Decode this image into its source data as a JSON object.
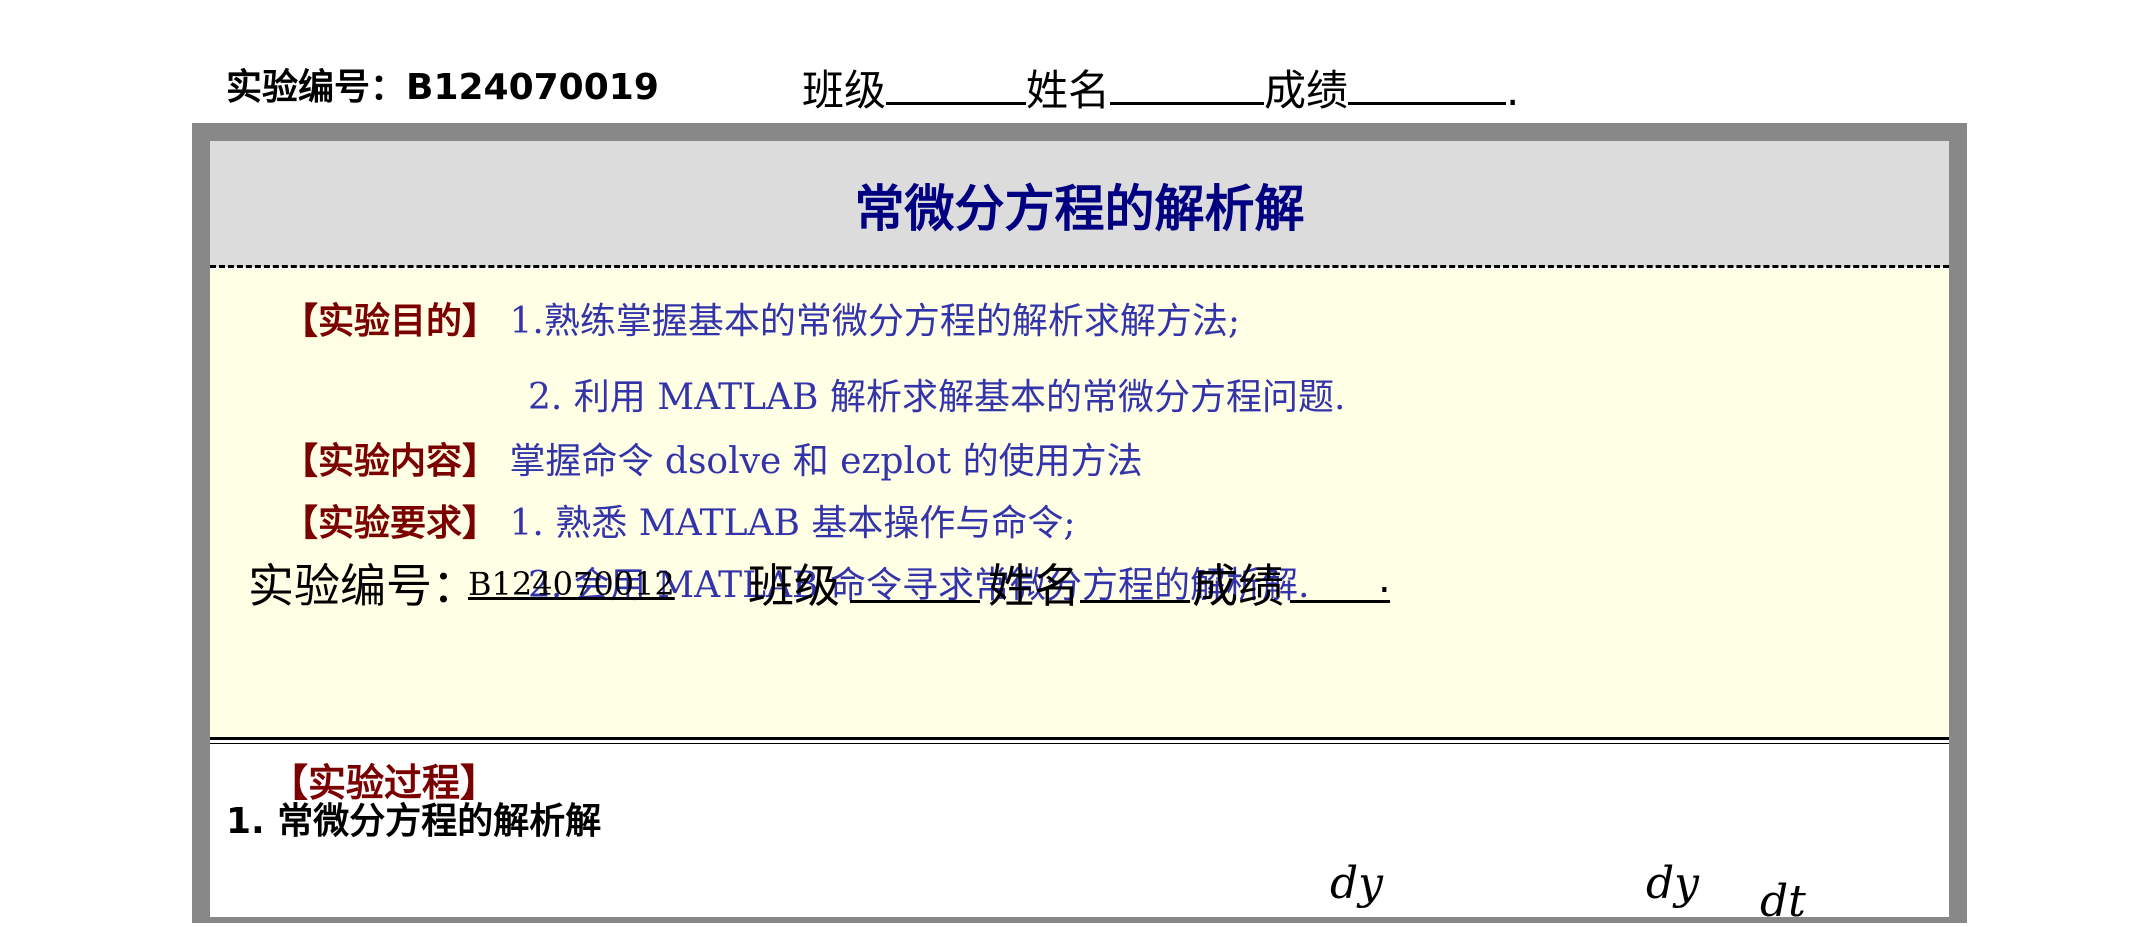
{
  "header": {
    "exp_label": "实验编号：B124070019",
    "class_label": "班级",
    "name_label": "姓名",
    "score_label": "成绩",
    "end_mark": "."
  },
  "title": "常微分方程的解析解",
  "objectives": {
    "purpose_tag": "【实验目的】",
    "purpose_1": "1.熟练掌握基本的常微分方程的解析求解方法;",
    "purpose_2": "2. 利用 MATLAB 解析求解基本的常微分方程问题.",
    "content_tag": "【实验内容】",
    "content": "掌握命令 dsolve 和 ezplot 的使用方法",
    "require_tag": "【实验要求】",
    "require_1": "1. 熟悉 MATLAB 基本操作与命令;",
    "require_2": "2. 会用 MATLAB 命令寻求常微分方程的解析解."
  },
  "overlay": {
    "exp_label": "实验编号：",
    "exp_number": "B124070012",
    "class_label": "班级",
    "name_label": "姓名",
    "score_label": "成绩",
    "end_mark": "."
  },
  "process": {
    "tag": "【实验过程】",
    "section": "1. 常微分方程的解析解",
    "math_1": "dy",
    "math_2": "dy",
    "math_3": "dt"
  }
}
